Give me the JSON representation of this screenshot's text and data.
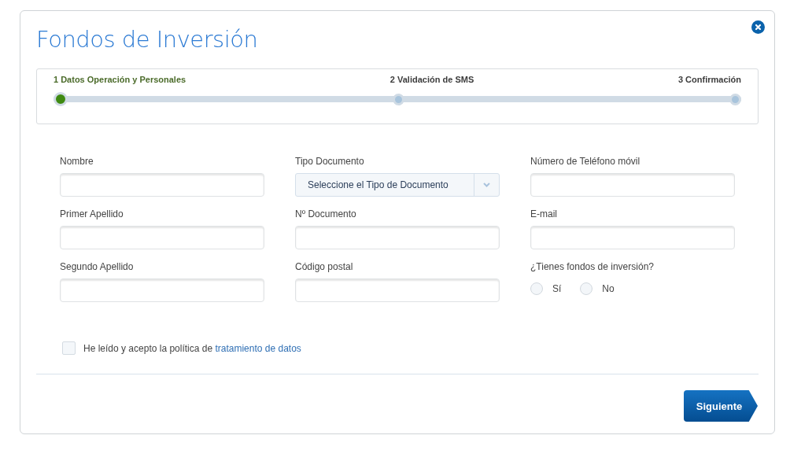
{
  "window": {
    "title": "Fondos de Inversión"
  },
  "steps": [
    {
      "label": "1 Datos Operación y Personales",
      "selected": true
    },
    {
      "label": "2 Validación de SMS",
      "selected": false
    },
    {
      "label": "3 Confirmación",
      "selected": false
    }
  ],
  "columns": [
    {
      "fields": [
        {
          "kind": "text",
          "label": "Nombre"
        },
        {
          "kind": "text",
          "label": "Primer Apellido"
        },
        {
          "kind": "text",
          "label": "Segundo Apellido"
        }
      ]
    },
    {
      "fields": [
        {
          "kind": "select",
          "label": "Tipo Documento",
          "value": "Seleccione el Tipo de Documento"
        },
        {
          "kind": "text",
          "label": "Nº Documento"
        },
        {
          "kind": "text",
          "label": "Código postal"
        }
      ]
    },
    {
      "fields": [
        {
          "kind": "text",
          "label": "Número de Teléfono móvil"
        },
        {
          "kind": "text",
          "label": "E-mail"
        },
        {
          "kind": "radio",
          "label": "¿Tienes fondos de inversión?",
          "options": [
            {
              "label": "Sí",
              "selected": false
            },
            {
              "label": "No",
              "selected": false
            }
          ]
        }
      ]
    }
  ],
  "consent": {
    "text": "He leído y acepto la política de",
    "link": "tratamiento de datos",
    "checked": false
  },
  "buttons": {
    "next": "Siguiente"
  }
}
